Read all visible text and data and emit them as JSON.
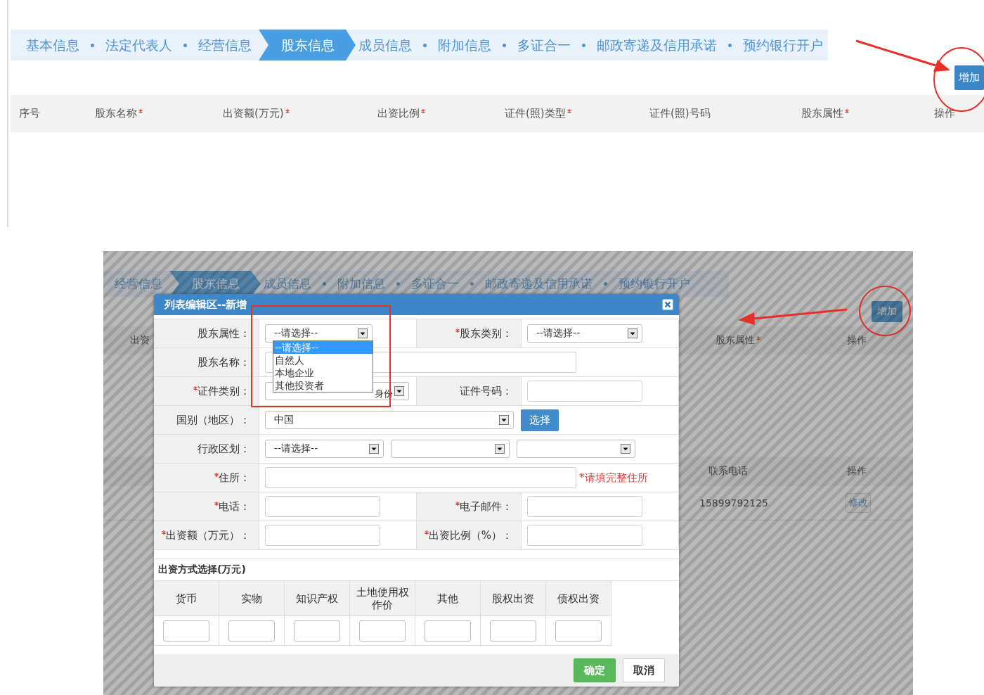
{
  "top": {
    "steps": [
      {
        "label": "基本信息",
        "selected": false
      },
      {
        "label": "法定代表人",
        "selected": false
      },
      {
        "label": "经营信息",
        "selected": false
      },
      {
        "label": "股东信息",
        "selected": true
      },
      {
        "label": "成员信息",
        "selected": false
      },
      {
        "label": "附加信息",
        "selected": false
      },
      {
        "label": "多证合一",
        "selected": false
      },
      {
        "label": "邮政寄递及信用承诺",
        "selected": false
      },
      {
        "label": "预约银行开户",
        "selected": false
      }
    ],
    "add_button": "增加",
    "columns": [
      {
        "label": "序号",
        "required": false
      },
      {
        "label": "股东名称",
        "required": true
      },
      {
        "label": "出资额(万元)",
        "required": true
      },
      {
        "label": "出资比例",
        "required": true
      },
      {
        "label": "证件(照)类型",
        "required": true
      },
      {
        "label": "证件(照)号码",
        "required": false
      },
      {
        "label": "股东属性",
        "required": true
      },
      {
        "label": "操作",
        "required": false
      }
    ]
  },
  "lower": {
    "background": {
      "steps": [
        {
          "label": "经营信息",
          "selected": false
        },
        {
          "label": "股东信息",
          "selected": true
        },
        {
          "label": "成员信息",
          "selected": false
        },
        {
          "label": "附加信息",
          "selected": false
        },
        {
          "label": "多证合一",
          "selected": false
        },
        {
          "label": "邮政寄递及信用承诺",
          "selected": false
        },
        {
          "label": "预约银行开户",
          "selected": false
        }
      ],
      "add_button": "增加",
      "columns": [
        {
          "label": "出资",
          "required": false
        },
        {
          "label": "股东属性",
          "required": true
        },
        {
          "label": "操作",
          "required": false
        }
      ],
      "member_columns": [
        "联系电话",
        "操作"
      ],
      "member_row": {
        "phone": "15899792125",
        "action": "修改"
      }
    },
    "dialog": {
      "title": "列表编辑区--新增",
      "rows": [
        {
          "kind": "pair",
          "fields": [
            {
              "label": "股东属性：",
              "required": false,
              "controls": [
                {
                  "kind": "select",
                  "value": "--请选择--",
                  "expanded": true,
                  "options": [
                    {
                      "label": "--请选择--",
                      "selected": true
                    },
                    {
                      "label": "自然人",
                      "selected": false
                    },
                    {
                      "label": "本地企业",
                      "selected": false
                    },
                    {
                      "label": "其他投资者",
                      "selected": false
                    }
                  ]
                }
              ]
            },
            {
              "label": "股东类别：",
              "required": true,
              "controls": [
                {
                  "kind": "select",
                  "value": "--请选择--",
                  "expanded": false
                }
              ]
            }
          ]
        },
        {
          "kind": "full",
          "fields": [
            {
              "label": "股东名称：",
              "required": false,
              "controls": [
                {
                  "kind": "input"
                }
              ]
            }
          ]
        },
        {
          "kind": "pair",
          "fields": [
            {
              "label": "证件类别：",
              "required": true,
              "controls": [
                {
                  "kind": "select",
                  "value": "身份",
                  "expanded": false
                }
              ]
            },
            {
              "label": "证件号码：",
              "required": false,
              "controls": [
                {
                  "kind": "input"
                }
              ]
            }
          ]
        },
        {
          "kind": "full",
          "fields": [
            {
              "label": "国别（地区）：",
              "required": false,
              "controls": [
                {
                  "kind": "select",
                  "value": "中国",
                  "expanded": false
                },
                {
                  "kind": "button",
                  "label": "选择"
                }
              ]
            }
          ]
        },
        {
          "kind": "full",
          "fields": [
            {
              "label": "行政区划：",
              "required": false,
              "controls": [
                {
                  "kind": "select",
                  "value": "--请选择--",
                  "expanded": false
                },
                {
                  "kind": "select",
                  "expanded": false
                },
                {
                  "kind": "select",
                  "expanded": false
                }
              ]
            }
          ]
        },
        {
          "kind": "full",
          "fields": [
            {
              "label": "住所：",
              "required": true,
              "controls": [
                {
                  "kind": "input"
                },
                {
                  "kind": "hint",
                  "text": "*请填完整住所"
                }
              ]
            }
          ]
        },
        {
          "kind": "pair",
          "fields": [
            {
              "label": "电话：",
              "required": true,
              "controls": [
                {
                  "kind": "input"
                }
              ]
            },
            {
              "label": "电子邮件：",
              "required": true,
              "controls": [
                {
                  "kind": "input"
                }
              ]
            }
          ]
        },
        {
          "kind": "pair",
          "fields": [
            {
              "label": "出资额（万元）：",
              "required": true,
              "controls": [
                {
                  "kind": "input"
                }
              ]
            },
            {
              "label": "出资比例（%）：",
              "required": true,
              "controls": [
                {
                  "kind": "input"
                }
              ]
            }
          ]
        }
      ],
      "section_title": "出资方式选择(万元)",
      "contribution_columns": [
        "货币",
        "实物",
        "知识产权",
        "土地使用权作价",
        "其他",
        "股权出资",
        "债权出资"
      ],
      "buttons": [
        {
          "label": "确定",
          "kind": "primary"
        },
        {
          "label": "取消",
          "kind": "default"
        }
      ]
    }
  }
}
